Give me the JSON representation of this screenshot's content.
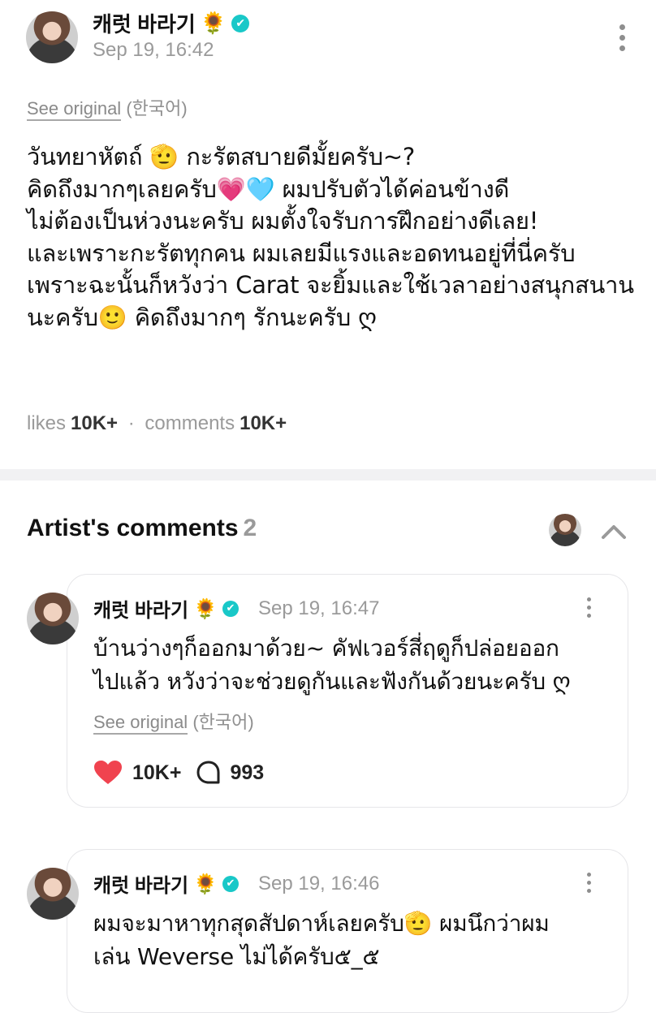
{
  "post": {
    "author_name": "캐럿 바라기",
    "author_emoji": "🌻",
    "verified_glyph": "✔",
    "timestamp": "Sep 19, 16:42",
    "see_original": "See original",
    "original_language": "(한국어)",
    "body_lines": [
      "วันทยาหัตถ์ 🫡 กะรัตสบายดีมั้ยครับ~?",
      "คิดถึงมากๆเลยครับ💗🩵 ผมปรับตัวได้ค่อนข้างดี",
      "ไม่ต้องเป็นห่วงนะครับ ผมตั้งใจรับการฝึกอย่างดีเลย!",
      "และเพราะกะรัตทุกคน ผมเลยมีแรงและอดทนอยู่ที่นี่ครับ",
      "เพราะฉะนั้นก็หวังว่า Carat จะยิ้มและใช้เวลาอย่างสนุกสนาน",
      "นะครับ🙂 คิดถึงมากๆ รักนะครับ ღ"
    ],
    "likes_label": "likes",
    "likes_count": "10K+",
    "separator": "·",
    "comments_label": "comments",
    "comments_count": "10K+"
  },
  "artist_comments": {
    "title": "Artist's comments",
    "count": "2",
    "items": [
      {
        "author_name": "캐럿 바라기",
        "author_emoji": "🌻",
        "verified_glyph": "✔",
        "timestamp": "Sep 19, 16:47",
        "text_lines": [
          "บ้านว่างๆก็ออกมาด้วย~ คัฟเวอร์สี่ฤดูก็ปล่อยออก",
          "ไปแล้ว หวังว่าจะช่วยดูกันและฟังกันด้วยนะครับ ღ"
        ],
        "see_original": "See original",
        "original_language": "(한국어)",
        "likes": "10K+",
        "replies": "993"
      },
      {
        "author_name": "캐럿 바라기",
        "author_emoji": "🌻",
        "verified_glyph": "✔",
        "timestamp": "Sep 19, 16:46",
        "text_lines": [
          "ผมจะมาหาทุกสุดสัปดาห์เลยครับ🫡 ผมนึกว่าผม",
          "เล่น Weverse ไม่ได้ครับ๕_๕"
        ]
      }
    ]
  },
  "colors": {
    "accent_verified": "#19c8c8",
    "heart": "#f0434f",
    "muted_text": "#9a9a9a"
  },
  "icons": {
    "more": "more-vertical-icon",
    "verified": "verified-badge-icon",
    "collapse": "chevron-up-icon",
    "like": "heart-icon",
    "reply": "comment-bubble-icon"
  }
}
